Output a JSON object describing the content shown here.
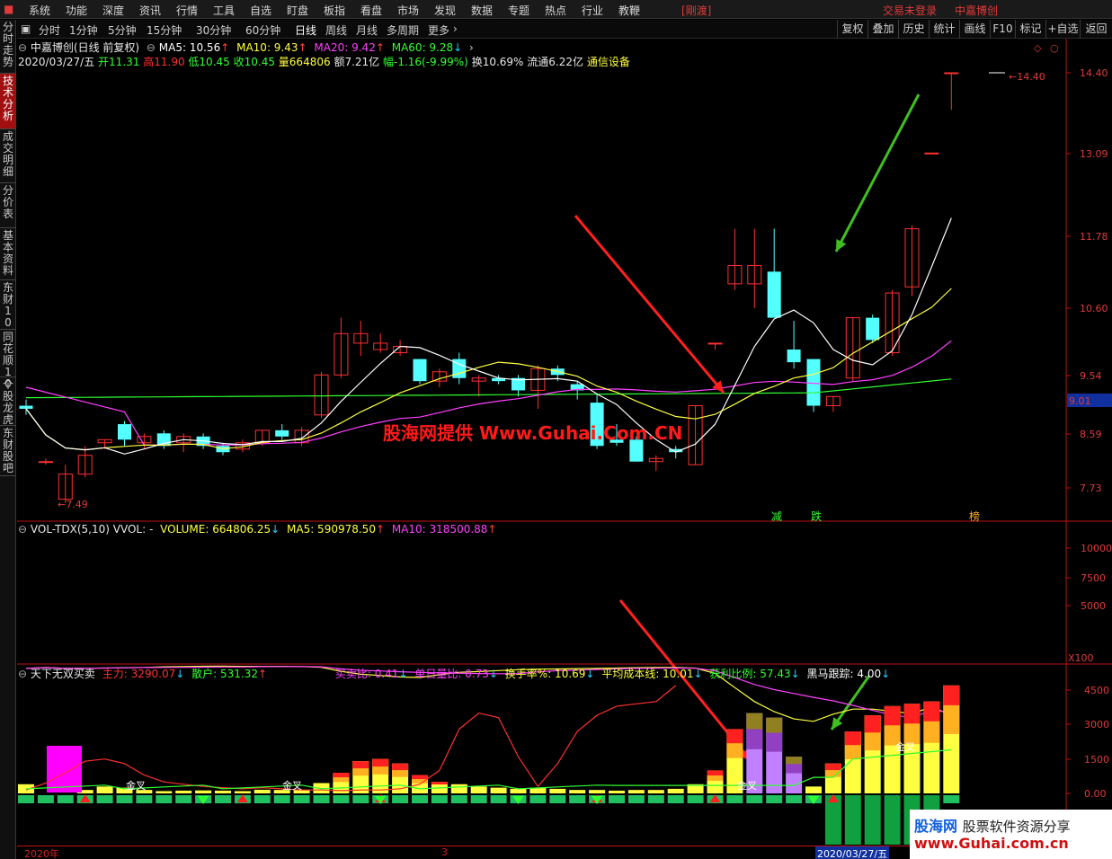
{
  "menubar": {
    "items": [
      "系统",
      "功能",
      "深度",
      "资讯",
      "行情",
      "工具",
      "自选",
      "盯盘",
      "板指",
      "看盘",
      "市场",
      "发现",
      "数据",
      "专题",
      "热点",
      "行业",
      "教鞭"
    ],
    "badge": "[剛渡]",
    "login": "交易未登录",
    "stock": "中嘉博创"
  },
  "toolbar": {
    "periods": [
      "分时",
      "1分钟",
      "5分钟",
      "15分钟",
      "30分钟",
      "60分钟",
      "日线",
      "周线",
      "月线",
      "多周期",
      "更多"
    ],
    "active_period": "日线",
    "buttons": [
      "复权",
      "叠加",
      "历史",
      "统计",
      "画线",
      "F10",
      "标记",
      "+自选",
      "返回"
    ]
  },
  "sidebar": {
    "tabs": [
      "分时走势",
      "技术分析",
      "成交明细",
      "分价表",
      "基本资料",
      "东财10",
      "同花顺10",
      "个股龙虎",
      "东财股吧"
    ],
    "active": "技术分析"
  },
  "main_info": {
    "title": "中嘉博创(日线 前复权)",
    "ma5": "MA5: 10.56",
    "ma10": "MA10: 9.43",
    "ma20": "MA20: 9.42",
    "ma60": "MA60: 9.28",
    "date": "2020/03/27/五",
    "open": "开11.31",
    "high": "高11.90",
    "low": "低10.45",
    "close": "收10.45",
    "volume": "量664806",
    "amount": "额7.21亿",
    "change": "幅-1.16(-9.99%)",
    "turnover": "换10.69%",
    "float": "流通6.22亿",
    "industry": "通信设备"
  },
  "vol_info": {
    "name": "VOL-TDX(5,10)",
    "vvol": "VVOL: -",
    "volume": "VOLUME: 664806.25",
    "ma5": "MA5: 590978.50",
    "ma10": "MA10: 318500.88"
  },
  "ind_info": {
    "name": "天下无双买卖",
    "zhuli": "主力: 3290.07",
    "sanhu": "散户: 531.32",
    "maimaibi": "买卖比: 0.41",
    "danriliangbi": "单日量比: 0.73",
    "huanshoulv": "换手率%: 10.69",
    "pingjunchengben": "平均成本线: 10.01",
    "huolibili": "获利比例: 57.43",
    "heima": "黑马跟踪: 4.00"
  },
  "price_axis": [
    "14.40",
    "13.09",
    "11.78",
    "10.60",
    "9.54",
    "8.59",
    "7.73"
  ],
  "current_price": "9.01",
  "high_label": "14.40",
  "low_label": "7.49",
  "vol_axis": [
    "10000",
    "7500",
    "5000"
  ],
  "vol_unit": "X100",
  "ind_axis": [
    "4500",
    "3000",
    "1500",
    "0.00"
  ],
  "markers": {
    "jian": "减",
    "die": "跌",
    "bang": "榜"
  },
  "cross_label": "金叉",
  "watermark": "股海网提供 Www.Guhai.Com.CN",
  "logo": {
    "line1a": "股海网",
    "line1b": "股票软件资源分享",
    "line2": "www.Guhai.com.cn"
  },
  "dates": {
    "year": "2020年",
    "month": "3",
    "current": "2020/03/27/五"
  },
  "colors": {
    "up": "#ff3030",
    "down": "#54ffff",
    "ma5": "#ffffff",
    "ma10": "#ffff40",
    "ma20": "#ff40ff",
    "ma60": "#30ff30",
    "accent": "#e03a3a"
  },
  "chart_data": [
    {
      "type": "candlestick",
      "title": "中嘉博创(日线 前复权)",
      "ylim": [
        7.2,
        14.8
      ],
      "candles": [
        {
          "o": 9.05,
          "h": 9.15,
          "l": 8.9,
          "c": 9.0
        },
        {
          "o": 8.15,
          "h": 8.2,
          "l": 8.1,
          "c": 8.15
        },
        {
          "o": 7.55,
          "h": 8.1,
          "l": 7.49,
          "c": 7.95
        },
        {
          "o": 7.95,
          "h": 8.4,
          "l": 7.9,
          "c": 8.25
        },
        {
          "o": 8.45,
          "h": 8.5,
          "l": 8.35,
          "c": 8.5
        },
        {
          "o": 8.75,
          "h": 8.8,
          "l": 8.4,
          "c": 8.5
        },
        {
          "o": 8.45,
          "h": 8.6,
          "l": 8.35,
          "c": 8.55
        },
        {
          "o": 8.6,
          "h": 8.65,
          "l": 8.35,
          "c": 8.4
        },
        {
          "o": 8.45,
          "h": 8.6,
          "l": 8.3,
          "c": 8.55
        },
        {
          "o": 8.55,
          "h": 8.6,
          "l": 8.35,
          "c": 8.4
        },
        {
          "o": 8.4,
          "h": 8.45,
          "l": 8.25,
          "c": 8.3
        },
        {
          "o": 8.35,
          "h": 8.5,
          "l": 8.3,
          "c": 8.45
        },
        {
          "o": 8.45,
          "h": 8.65,
          "l": 8.4,
          "c": 8.65
        },
        {
          "o": 8.65,
          "h": 8.75,
          "l": 8.5,
          "c": 8.55
        },
        {
          "o": 8.45,
          "h": 8.7,
          "l": 8.4,
          "c": 8.65
        },
        {
          "o": 8.9,
          "h": 9.6,
          "l": 8.85,
          "c": 9.55
        },
        {
          "o": 9.55,
          "h": 10.45,
          "l": 9.5,
          "c": 10.2
        },
        {
          "o": 10.05,
          "h": 10.4,
          "l": 9.85,
          "c": 10.2
        },
        {
          "o": 9.95,
          "h": 10.2,
          "l": 9.9,
          "c": 10.05
        },
        {
          "o": 9.9,
          "h": 10.1,
          "l": 9.85,
          "c": 10.0
        },
        {
          "o": 9.8,
          "h": 9.8,
          "l": 9.4,
          "c": 9.45
        },
        {
          "o": 9.45,
          "h": 9.65,
          "l": 9.35,
          "c": 9.6
        },
        {
          "o": 9.8,
          "h": 9.9,
          "l": 9.4,
          "c": 9.5
        },
        {
          "o": 9.45,
          "h": 9.55,
          "l": 9.2,
          "c": 9.5
        },
        {
          "o": 9.5,
          "h": 9.55,
          "l": 9.4,
          "c": 9.45
        },
        {
          "o": 9.5,
          "h": 9.55,
          "l": 9.2,
          "c": 9.3
        },
        {
          "o": 9.3,
          "h": 9.7,
          "l": 9.0,
          "c": 9.65
        },
        {
          "o": 9.65,
          "h": 9.7,
          "l": 9.45,
          "c": 9.55
        },
        {
          "o": 9.4,
          "h": 9.45,
          "l": 9.15,
          "c": 9.3
        },
        {
          "o": 9.1,
          "h": 9.25,
          "l": 8.35,
          "c": 8.4
        },
        {
          "o": 8.5,
          "h": 8.75,
          "l": 8.4,
          "c": 8.45
        },
        {
          "o": 8.5,
          "h": 8.55,
          "l": 8.15,
          "c": 8.15
        },
        {
          "o": 8.15,
          "h": 8.25,
          "l": 8.0,
          "c": 8.2
        },
        {
          "o": 8.35,
          "h": 8.4,
          "l": 8.2,
          "c": 8.3
        },
        {
          "o": 8.1,
          "h": 9.05,
          "l": 8.1,
          "c": 9.05
        },
        {
          "o": 10.05,
          "h": 10.05,
          "l": 9.95,
          "c": 10.05
        },
        {
          "o": 11.0,
          "h": 11.9,
          "l": 10.9,
          "c": 11.3
        },
        {
          "o": 11.0,
          "h": 11.9,
          "l": 10.6,
          "c": 11.3
        },
        {
          "o": 11.2,
          "h": 11.9,
          "l": 10.45,
          "c": 10.45
        },
        {
          "o": 9.95,
          "h": 10.4,
          "l": 9.65,
          "c": 9.75
        },
        {
          "o": 9.8,
          "h": 9.8,
          "l": 8.95,
          "c": 9.05
        },
        {
          "o": 9.05,
          "h": 9.2,
          "l": 8.95,
          "c": 9.2
        },
        {
          "o": 9.5,
          "h": 10.45,
          "l": 9.45,
          "c": 10.45
        },
        {
          "o": 10.45,
          "h": 10.5,
          "l": 10.05,
          "c": 10.1
        },
        {
          "o": 9.9,
          "h": 10.9,
          "l": 9.85,
          "c": 10.85
        },
        {
          "o": 10.95,
          "h": 11.95,
          "l": 10.8,
          "c": 11.9
        },
        {
          "o": 13.1,
          "h": 13.1,
          "l": 13.1,
          "c": 13.1
        },
        {
          "o": 14.4,
          "h": 14.4,
          "l": 13.8,
          "c": 14.4
        }
      ]
    }
  ]
}
